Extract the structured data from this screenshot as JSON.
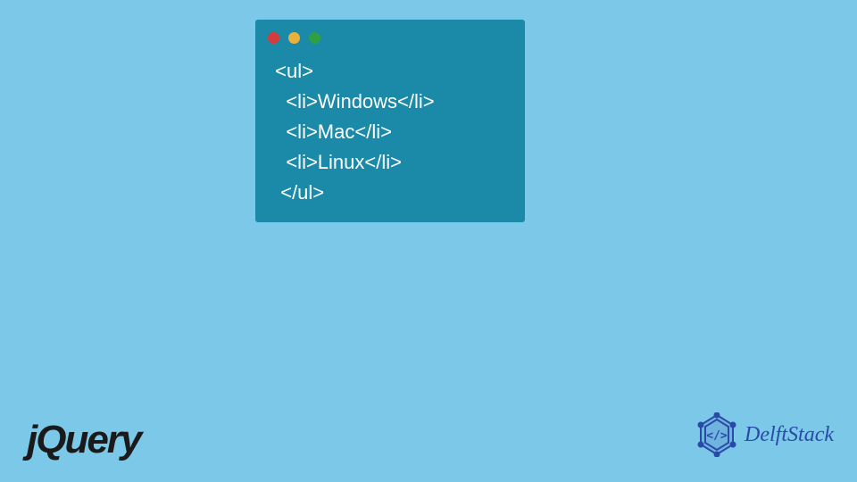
{
  "code": {
    "line1": " <ul>",
    "line2": "   <li>Windows</li>",
    "line3": "   <li>Mac</li>",
    "line4": "   <li>Linux</li>",
    "line5": "  </ul>"
  },
  "logos": {
    "jquery": "jQuery",
    "delftstack": "DelftStack"
  },
  "colors": {
    "background": "#7cc8e8",
    "codeWindow": "#1a8aa8",
    "dotRed": "#d63b3b",
    "dotYellow": "#e8b23c",
    "dotGreen": "#2ea043",
    "delftBlue": "#2a4aa8"
  }
}
